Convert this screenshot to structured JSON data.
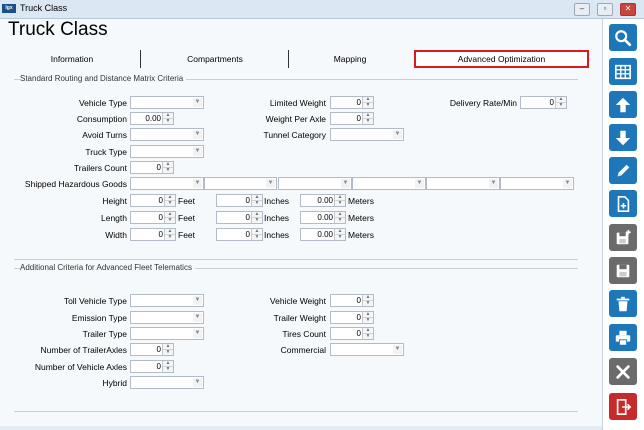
{
  "window": {
    "app_logo": "lgx",
    "title": "Truck Class",
    "minimize": "–",
    "restore": "▫",
    "close": "✕"
  },
  "page": {
    "title": "Truck Class"
  },
  "tabs": [
    {
      "label": "Information"
    },
    {
      "label": "Compartments"
    },
    {
      "label": "Mapping"
    },
    {
      "label": "Advanced Optimization",
      "active": true
    }
  ],
  "section1": {
    "title": "Standard Routing and Distance Matrix Criteria",
    "vehicle_type": {
      "label": "Vehicle Type",
      "value": ""
    },
    "consumption": {
      "label": "Consumption",
      "value": "0.00"
    },
    "avoid_turns": {
      "label": "Avoid Turns",
      "value": ""
    },
    "truck_type": {
      "label": "Truck Type",
      "value": ""
    },
    "trailers_count": {
      "label": "Trailers Count",
      "value": "0"
    },
    "limited_weight": {
      "label": "Limited Weight",
      "value": "0"
    },
    "weight_per_axle": {
      "label": "Weight Per Axle",
      "value": "0"
    },
    "tunnel_category": {
      "label": "Tunnel Category",
      "value": ""
    },
    "delivery_rate": {
      "label": "Delivery Rate/Min",
      "value": "0"
    },
    "shipped_hazardous_goods": {
      "label": "Shipped Hazardous Goods",
      "values": [
        "",
        "",
        "",
        "",
        "",
        "",
        ""
      ]
    },
    "height": {
      "label": "Height",
      "feet": "0",
      "inches": "0",
      "meters": "0.00"
    },
    "length": {
      "label": "Length",
      "feet": "0",
      "inches": "0",
      "meters": "0.00"
    },
    "width": {
      "label": "Width",
      "feet": "0",
      "inches": "0",
      "meters": "0.00"
    },
    "units": {
      "feet": "Feet",
      "inches": "Inches",
      "meters": "Meters"
    }
  },
  "section2": {
    "title": "Additional Criteria for Advanced Fleet Telematics",
    "toll_vehicle_type": {
      "label": "Toll Vehicle Type",
      "value": ""
    },
    "emission_type": {
      "label": "Emission Type",
      "value": ""
    },
    "trailer_type": {
      "label": "Trailer Type",
      "value": ""
    },
    "number_trailer_axles": {
      "label": "Number of TrailerAxles",
      "value": "0"
    },
    "number_vehicle_axles": {
      "label": "Number of Vehicle Axles",
      "value": "0"
    },
    "hybrid": {
      "label": "Hybrid",
      "value": ""
    },
    "vehicle_weight": {
      "label": "Vehicle Weight",
      "value": "0"
    },
    "trailer_weight": {
      "label": "Trailer Weight",
      "value": "0"
    },
    "tires_count": {
      "label": "Tires Count",
      "value": "0"
    },
    "commercial": {
      "label": "Commercial",
      "value": ""
    }
  },
  "toolbar": [
    {
      "icon": "search-icon",
      "color": "#1d77b9"
    },
    {
      "icon": "grid-icon",
      "color": "#1d77b9"
    },
    {
      "icon": "arrow-up-icon",
      "color": "#1d77b9"
    },
    {
      "icon": "arrow-down-icon",
      "color": "#1d77b9"
    },
    {
      "icon": "pencil-icon",
      "color": "#1d77b9"
    },
    {
      "icon": "new-document-icon",
      "color": "#1d77b9"
    },
    {
      "icon": "save-new-icon",
      "color": "#6b6b6b"
    },
    {
      "icon": "save-icon",
      "color": "#6b6b6b"
    },
    {
      "icon": "trash-icon",
      "color": "#1d77b9"
    },
    {
      "icon": "printer-icon",
      "color": "#1d77b9"
    },
    {
      "icon": "close-x-icon",
      "color": "#6b6b6b"
    },
    {
      "icon": "exit-door-icon",
      "color": "#c62a2a"
    }
  ]
}
